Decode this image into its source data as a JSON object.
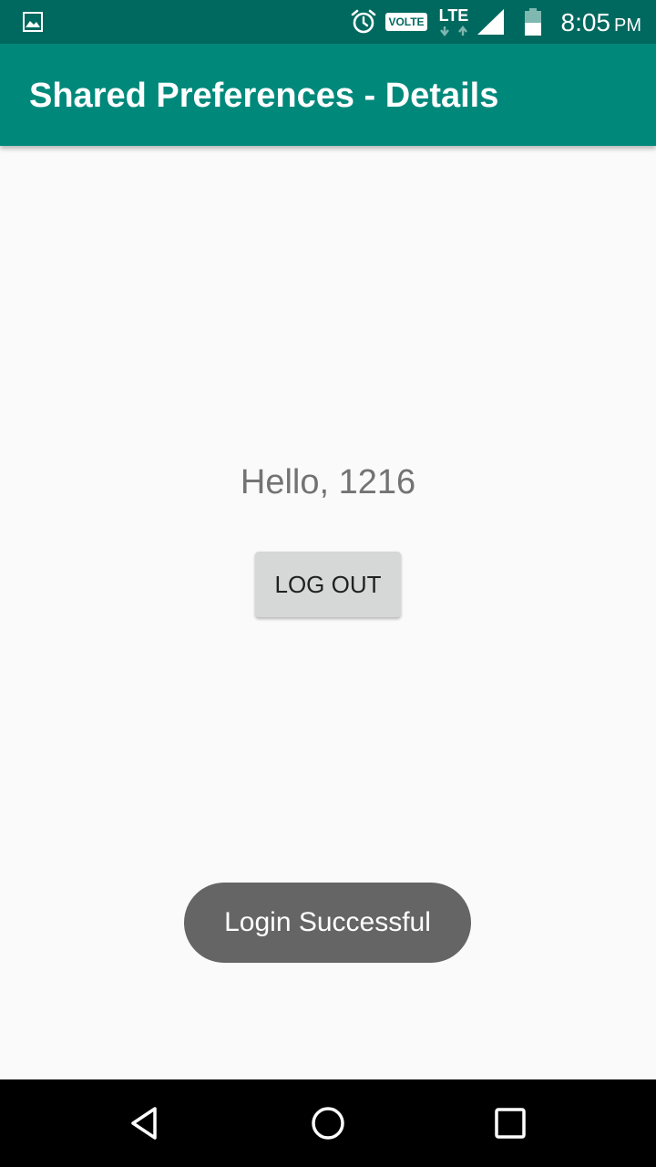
{
  "status_bar": {
    "volte_label": "VOLTE",
    "network_label": "LTE",
    "time": "8:05",
    "time_suffix": "PM",
    "icons": [
      "image-notification-icon",
      "alarm-icon",
      "volte-icon",
      "lte-icon",
      "signal-icon",
      "battery-icon"
    ]
  },
  "app_bar": {
    "title": "Shared Preferences - Details",
    "color": "#00897b"
  },
  "main": {
    "greeting": "Hello, 1216",
    "logout_label": "LOG OUT"
  },
  "toast": {
    "message": "Login Successful"
  },
  "nav_bar": {
    "icons": [
      "back-icon",
      "home-icon",
      "recents-icon"
    ]
  },
  "colors": {
    "status_bar": "#00695f",
    "app_bar": "#00897b",
    "background": "#fafafa",
    "button": "#d6d7d7",
    "toast": "#656565",
    "nav_bar": "#000000"
  }
}
